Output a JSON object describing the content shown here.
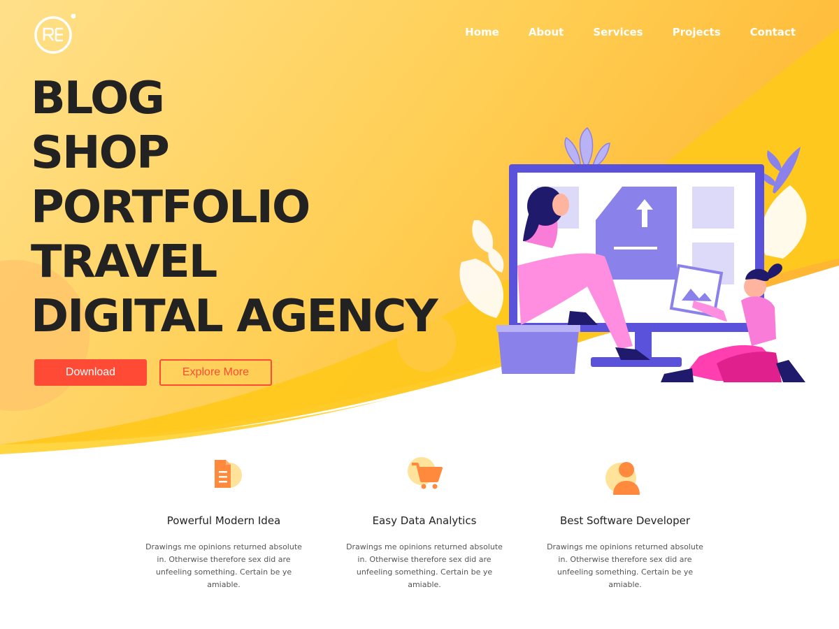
{
  "brand": {
    "logo_text": "RE"
  },
  "nav": {
    "items": [
      "Home",
      "About",
      "Services",
      "Projects",
      "Contact"
    ]
  },
  "hero": {
    "lines": [
      "BLOG",
      "SHOP",
      "PORTFOLIO",
      "TRAVEL",
      "DIGITAL AGENCY"
    ],
    "primary_button": "Download",
    "secondary_button": "Explore More"
  },
  "features": [
    {
      "icon": "document-icon",
      "title": "Powerful Modern Idea",
      "text": "Drawings me opinions returned absolute in. Otherwise therefore sex did are unfeeling something. Certain be ye amiable."
    },
    {
      "icon": "cart-icon",
      "title": "Easy Data Analytics",
      "text": "Drawings me opinions returned absolute in. Otherwise therefore sex did are unfeeling something. Certain be ye amiable."
    },
    {
      "icon": "user-icon",
      "title": "Best Software Developer",
      "text": "Drawings me opinions returned absolute in. Otherwise therefore sex did are unfeeling something. Certain be ye amiable."
    }
  ],
  "colors": {
    "accent": "#ff4a36",
    "hero_yellow": "#ffc81e",
    "icon_orange": "#ff8a3d",
    "icon_bg": "#ffe39a",
    "heading": "#222222"
  }
}
